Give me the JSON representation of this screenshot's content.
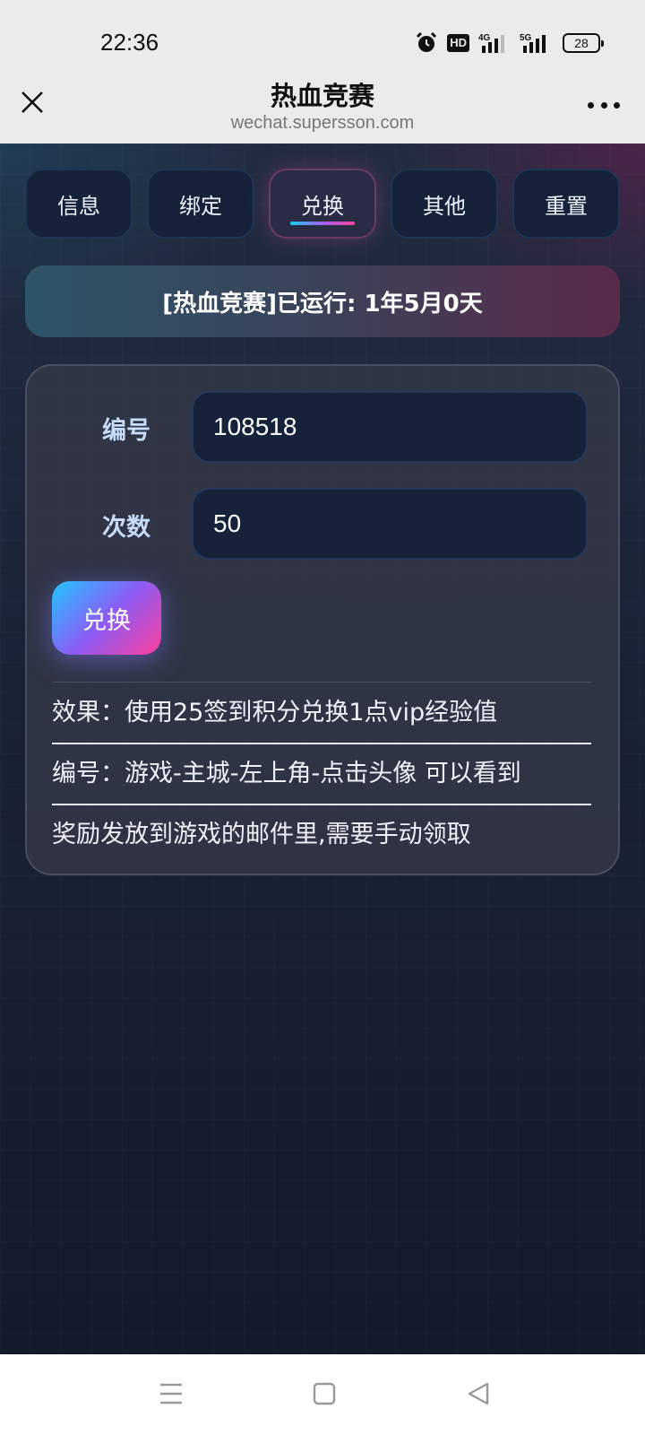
{
  "status": {
    "time": "22:36",
    "hd_label": "HD",
    "network_4g": "4G",
    "network_5g": "5G",
    "battery": "28"
  },
  "header": {
    "title": "热血竞赛",
    "url": "wechat.supersson.com"
  },
  "tabs": [
    {
      "label": "信息",
      "active": false
    },
    {
      "label": "绑定",
      "active": false
    },
    {
      "label": "兑换",
      "active": true
    },
    {
      "label": "其他",
      "active": false
    },
    {
      "label": "重置",
      "active": false
    }
  ],
  "banner": {
    "text": "[热血竞赛]已运行: 1年5月0天"
  },
  "form": {
    "id_label": "编号",
    "id_value": "108518",
    "count_label": "次数",
    "count_value": "50",
    "submit_label": "兑换"
  },
  "notes": [
    "效果：使用25签到积分兑换1点vip经验值",
    "编号：游戏-主城-左上角-点击头像 可以看到",
    "奖励发放到游戏的邮件里,需要手动领取"
  ],
  "colors": {
    "accent_start": "#21c6ff",
    "accent_mid": "#8b5cf6",
    "accent_end": "#ff3f9c",
    "card_bg": "#343848",
    "input_bg": "#15223a",
    "label_color": "#c7dcfb"
  },
  "icons": {
    "close": "close-icon",
    "more": "more-icon",
    "alarm": "alarm-icon",
    "signal": "signal-icon",
    "battery": "battery-icon",
    "nav_menu": "menu-icon",
    "nav_home": "home-icon",
    "nav_back": "back-icon"
  }
}
